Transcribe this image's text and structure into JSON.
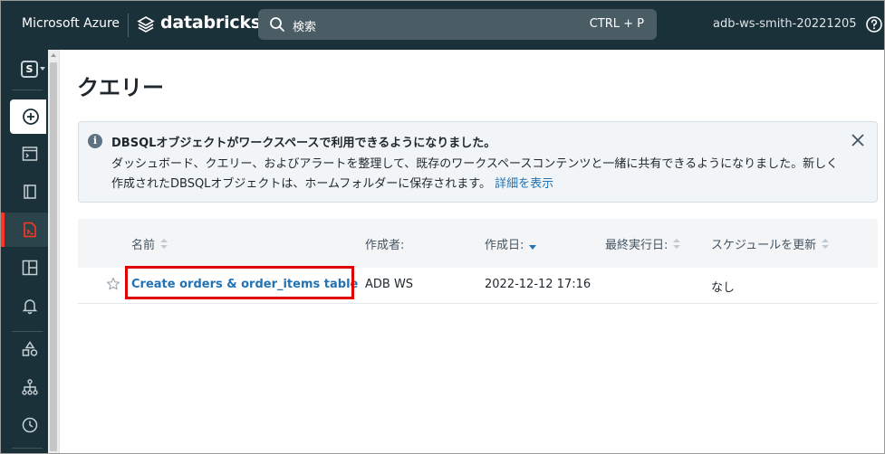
{
  "topbar": {
    "azure_label": "Microsoft Azure",
    "databricks_label": "databricks",
    "search_placeholder": "検索",
    "search_shortcut": "CTRL + P",
    "workspace_name": "adb-ws-smith-20221205"
  },
  "sidebar": {
    "workspace_badge": "S",
    "items": [
      {
        "name": "new",
        "icon": "plus-circle-icon"
      },
      {
        "name": "sql-editor",
        "icon": "sql-editor-icon"
      },
      {
        "name": "catalog",
        "icon": "catalog-icon"
      },
      {
        "name": "queries",
        "icon": "queries-icon",
        "active": true
      },
      {
        "name": "dashboards",
        "icon": "dashboard-icon"
      },
      {
        "name": "alerts",
        "icon": "bell-icon"
      },
      {
        "name": "data-science",
        "icon": "shapes-icon"
      },
      {
        "name": "workflows",
        "icon": "workflow-icon"
      },
      {
        "name": "history",
        "icon": "clock-icon"
      }
    ],
    "active_color": "#ff3621"
  },
  "page": {
    "title": "クエリー"
  },
  "banner": {
    "title": "DBSQLオブジェクトがワークスペースで利用できるようになりました。",
    "body": "ダッシュボード、クエリー、およびアラートを整理して、既存のワークスペースコンテンツと一緒に共有できるようになりました。新しく作成されたDBSQLオブジェクトは、ホームフォルダーに保存されます。",
    "link": "詳細を表示"
  },
  "table": {
    "columns": [
      {
        "label": "名前",
        "sort": "none"
      },
      {
        "label": "作成者:",
        "sort": "none"
      },
      {
        "label": "作成日:",
        "sort": "desc"
      },
      {
        "label": "最終実行日:",
        "sort": "none"
      },
      {
        "label": "スケジュールを更新",
        "sort": "none"
      }
    ],
    "rows": [
      {
        "name": "Create orders & order_items table",
        "created_by": "ADB WS",
        "created_at": "2022-12-12 17:16",
        "last_run": "",
        "schedule": "なし"
      }
    ]
  },
  "colors": {
    "topbar_bg": "#1b3139",
    "link": "#2272b4",
    "highlight": "#e00000"
  }
}
